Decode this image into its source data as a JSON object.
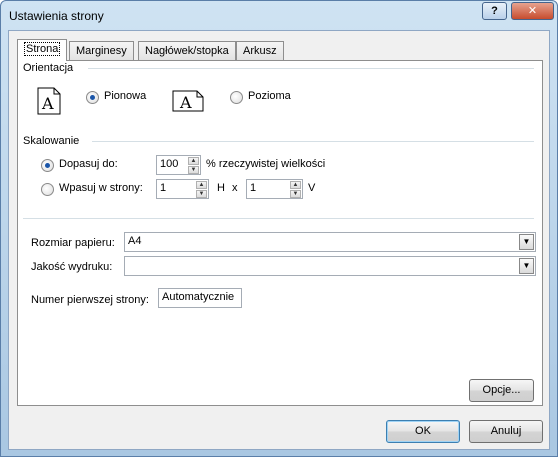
{
  "window": {
    "title": "Ustawienia strony",
    "help_label": "?",
    "close_label": "✕"
  },
  "tabs": [
    {
      "label": "Strona"
    },
    {
      "label": "Marginesy"
    },
    {
      "label": "Nagłówek/stopka"
    },
    {
      "label": "Arkusz"
    }
  ],
  "orientation": {
    "group_label": "Orientacja",
    "portrait_label": "Pionowa",
    "landscape_label": "Pozioma",
    "portrait_icon_letter": "A",
    "landscape_icon_letter": "A",
    "selected": "Pionowa"
  },
  "scaling": {
    "group_label": "Skalowanie",
    "adjust_label": "Dopasuj do:",
    "adjust_value": "100",
    "adjust_suffix": "% rzeczywistej wielkości",
    "fit_label": "Wpasuj w strony:",
    "fit_wide_value": "1",
    "fit_wide_suffix": "H",
    "times": "x",
    "fit_tall_value": "1",
    "fit_tall_suffix": "V",
    "selected": "Dopasuj do:"
  },
  "paper": {
    "size_label": "Rozmiar papieru:",
    "size_value": "A4",
    "quality_label": "Jakość wydruku:",
    "quality_value": "",
    "first_page_label": "Numer pierwszej strony:",
    "first_page_value": "Automatycznie"
  },
  "buttons": {
    "options": "Opcje...",
    "ok": "OK",
    "cancel": "Anuluj"
  },
  "icons": {
    "dropdown": "dropdown-arrow-icon",
    "spin_up": "spin-up-icon",
    "spin_down": "spin-down-icon"
  }
}
